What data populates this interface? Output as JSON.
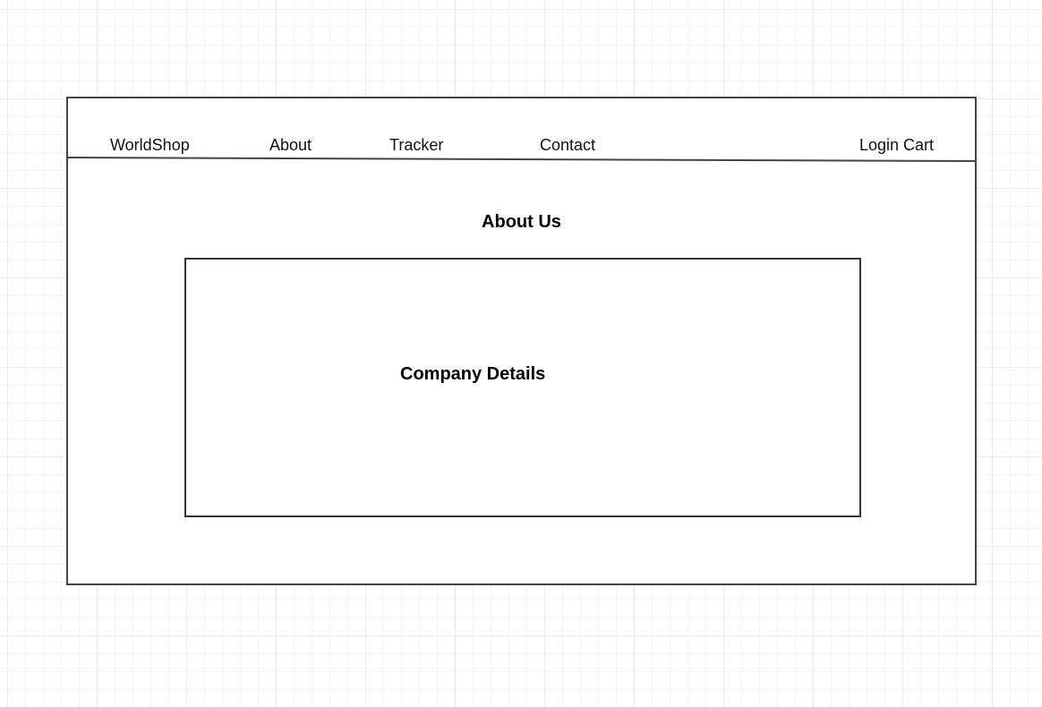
{
  "navbar": {
    "brand": "WorldShop",
    "items": [
      {
        "label": "About"
      },
      {
        "label": "Tracker"
      },
      {
        "label": "Contact"
      }
    ],
    "right_label": "Login Cart"
  },
  "main": {
    "title": "About Us",
    "details_box": {
      "label": "Company Details"
    }
  },
  "colors": {
    "border": "#444444",
    "grid": "#ececec",
    "text": "#111111"
  }
}
